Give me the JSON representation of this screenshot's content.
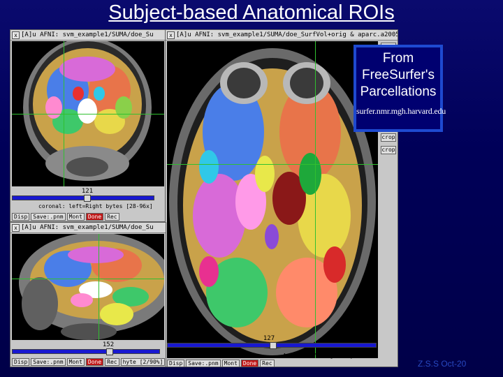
{
  "slide": {
    "title": "Subject-based Anatomical ROIs",
    "footer": "Z.S.S Oct-20"
  },
  "callout": {
    "line1": "From",
    "line2": "FreeSurfer's",
    "line3": "Parcellations",
    "url": "surfer.nmr.mgh.harvard.edu"
  },
  "windows": {
    "coronal": {
      "title": "[A]u AFNI: svm_example1/SUMA/doe_Su",
      "slice": "121",
      "readout": "coronal: left=Right bytes [28-96x]",
      "buttons": [
        "Disp",
        "Save:.pnm",
        "Mont",
        "Done",
        "Rec"
      ]
    },
    "axial": {
      "title": "[A]u AFNI: svm_example1/SUMA/doe_SurfVol+orig & aparc.a2005",
      "slice": "127",
      "readout": "Axial: left=Right: sys",
      "buttons": [
        "Disp",
        "Save:.pnm",
        "Mont",
        "Done",
        "Rec"
      ],
      "side_buttons": [
        "",
        "",
        "",
        "",
        "",
        "crop",
        "",
        "crop"
      ]
    },
    "sagittal": {
      "title": "[A]u AFNI: svm_example1/SUMA/doe_Su",
      "slice": "152",
      "readout": "hyte [2/90%]",
      "buttons": [
        "Disp",
        "Save:.pnm",
        "Mont",
        "Done",
        "Rec"
      ]
    }
  },
  "colors": {
    "background": "#000058",
    "callout_border": "#1e4ad0",
    "slider": "#1818d0",
    "done_button": "#c01818",
    "crosshair": "#30c030"
  }
}
